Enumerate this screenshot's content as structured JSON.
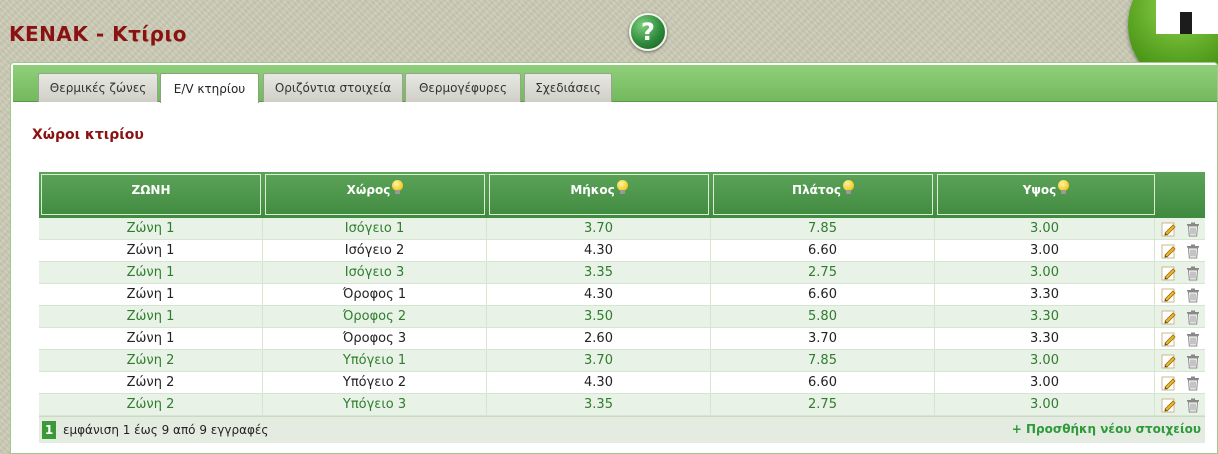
{
  "app": {
    "title": "KENAK - Κτίριο",
    "help_label": "?"
  },
  "tabs": [
    {
      "label": "Θερμικές ζώνες",
      "active": false
    },
    {
      "label": "Ε/V κτηρίου",
      "active": true
    },
    {
      "label": "Οριζόντια στοιχεία",
      "active": false
    },
    {
      "label": "Θερμογέφυρες",
      "active": false
    },
    {
      "label": "Σχεδιάσεις",
      "active": false
    }
  ],
  "section": {
    "title": "Χώροι κτιρίου"
  },
  "table": {
    "columns": [
      {
        "label": "ΖΩΝΗ",
        "hint": false
      },
      {
        "label": "Χώρος",
        "hint": true
      },
      {
        "label": "Μήκος",
        "hint": true
      },
      {
        "label": "Πλάτος",
        "hint": true
      },
      {
        "label": "Υψος",
        "hint": true
      }
    ],
    "rows": [
      [
        "Ζώνη 1",
        "Ισόγειο 1",
        "3.70",
        "7.85",
        "3.00"
      ],
      [
        "Ζώνη 1",
        "Ισόγειο 2",
        "4.30",
        "6.60",
        "3.00"
      ],
      [
        "Ζώνη 1",
        "Ισόγειο 3",
        "3.35",
        "2.75",
        "3.00"
      ],
      [
        "Ζώνη 1",
        "Όροφος 1",
        "4.30",
        "6.60",
        "3.30"
      ],
      [
        "Ζώνη 1",
        "Όροφος 2",
        "3.50",
        "5.80",
        "3.30"
      ],
      [
        "Ζώνη 1",
        "Όροφος 3",
        "2.60",
        "3.70",
        "3.30"
      ],
      [
        "Ζώνη 2",
        "Υπόγειο 1",
        "3.70",
        "7.85",
        "3.00"
      ],
      [
        "Ζώνη 2",
        "Υπόγειο 2",
        "4.30",
        "6.60",
        "3.00"
      ],
      [
        "Ζώνη 2",
        "Υπόγειο 3",
        "3.35",
        "2.75",
        "3.00"
      ]
    ],
    "row_actions": [
      "pencil-icon",
      "trash-icon"
    ]
  },
  "footer": {
    "page": "1",
    "info": "εμφάνιση 1 έως 9 από 9 εγγραφές",
    "add_label": "+ Προσθήκη νέου στοιχείου"
  },
  "colors": {
    "title_red": "#8b1212",
    "header_green": "#4c964a",
    "row_alt": "#e9f2e6",
    "link_green": "#2e9a3a"
  }
}
